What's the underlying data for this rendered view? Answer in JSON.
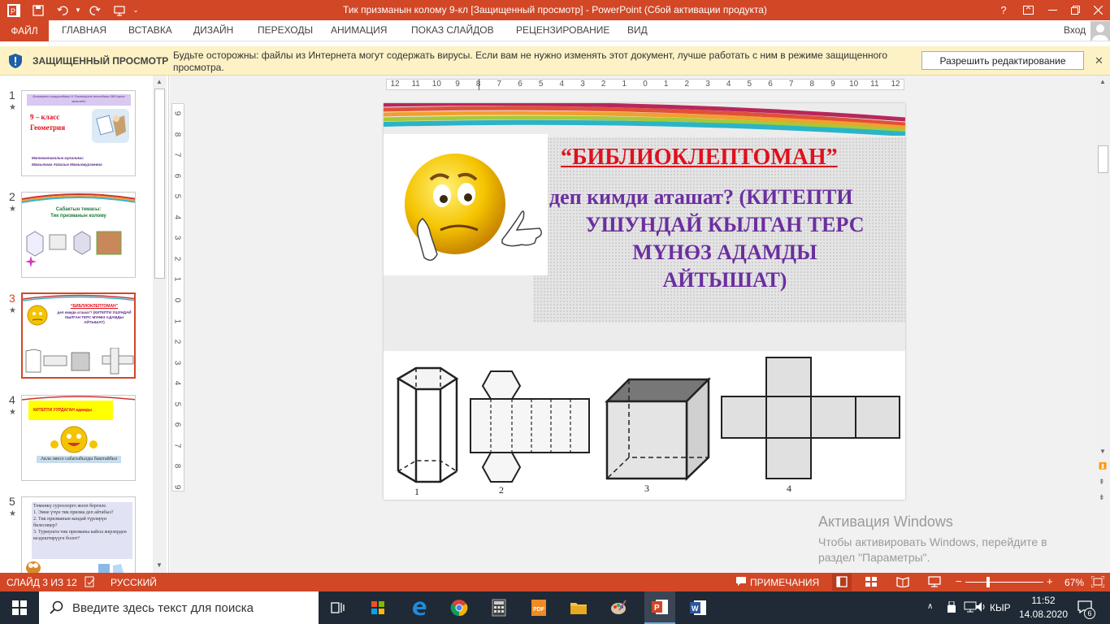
{
  "window": {
    "title": "Тик призманын колому 9-кл [Защищенный просмотр] -  PowerPoint (Сбой активации продукта)",
    "help": "?"
  },
  "ribbon": {
    "tabs": [
      "ФАЙЛ",
      "ГЛАВНАЯ",
      "ВСТАВКА",
      "ДИЗАЙН",
      "ПЕРЕХОДЫ",
      "АНИМАЦИЯ",
      "ПОКАЗ СЛАЙДОВ",
      "РЕЦЕНЗИРОВАНИЕ",
      "ВИД"
    ],
    "signin": "Вход"
  },
  "protected": {
    "label": "ЗАЩИЩЕННЫЙ ПРОСМОТР",
    "message": "Будьте осторожны: файлы из Интернета могут содержать вирусы. Если вам не нужно изменять этот документ, лучше работать с ним в режиме защищенного просмотра.",
    "button": "Разрешить редактирование"
  },
  "thumbnails": [
    {
      "num": "1",
      "star": "★",
      "line1": "Бозмерген шаарындагы Н.Токтогулов атындагы №8 орто мектеби",
      "title1": "9 – класс",
      "title2": "Геометрия",
      "footer1": "Математикалык мугалими:",
      "footer2": "Мамытова Айгазык Мамыкмурзаевна"
    },
    {
      "num": "2",
      "star": "★",
      "line1": "Сабактын темасы:",
      "line2": "Тик призманын колому"
    },
    {
      "num": "3",
      "star": "★",
      "line1": "“БИБЛИОКЛЕПТОМАН”",
      "line2": "деп кимди аташат? (КИТЕПТИ УШУНДАЙ КЫЛГАН ТЕРС МҮНӨЗ АДАМДЫ АЙТЫШАТ)"
    },
    {
      "num": "4",
      "star": "★",
      "line1": "КИТЕПТИ УУРДАГАН адамды",
      "line2": "Акла эмесе сабагыбызды баштайбыз"
    },
    {
      "num": "5",
      "star": "★",
      "text": "Төмөнкү суроолорго жооп бергиле.\n1. Эмне үчүн тик призма деп айтабыз?\n2. Тик призманын кандай түрлөрүн билесиңер?\n3. Турмушта тик призманы кайсы жерлерден кездештирүүгө болот?"
    }
  ],
  "ruler": {
    "h": [
      "12",
      "11",
      "10",
      "9",
      "8",
      "7",
      "6",
      "5",
      "4",
      "3",
      "2",
      "1",
      "0",
      "1",
      "2",
      "3",
      "4",
      "5",
      "6",
      "7",
      "8",
      "9",
      "10",
      "11",
      "12"
    ],
    "v": [
      "9",
      "8",
      "7",
      "6",
      "5",
      "4",
      "3",
      "2",
      "1",
      "0",
      "1",
      "2",
      "3",
      "4",
      "5",
      "6",
      "7",
      "8",
      "9"
    ]
  },
  "slide": {
    "heading": "“БИБЛИОКЛЕПТОМАН”",
    "lines": [
      "деп кимди аташат?  (КИТЕПТИ",
      "УШУНДАЙ КЫЛГАН ТЕРС",
      "МҮНӨЗ АДАМДЫ",
      "АЙТЫШАТ)"
    ],
    "figure_labels": [
      "1",
      "2",
      "3",
      "4"
    ]
  },
  "activation": {
    "title": "Активация Windows",
    "line1": "Чтобы активировать Windows, перейдите в",
    "line2": "раздел \"Параметры\"."
  },
  "status": {
    "slide": "СЛАЙД 3 ИЗ 12",
    "language": "РУССКИЙ",
    "notes": "ПРИМЕЧАНИЯ",
    "zoom": "67%"
  },
  "taskbar": {
    "search_placeholder": "Введите здесь текст для поиска",
    "lang": "КЫР",
    "time": "11:52",
    "date": "14.08.2020",
    "notif_count": "6"
  },
  "colors": {
    "accent": "#d24726",
    "slide_heading": "#e0101e",
    "slide_text": "#6b2fa0",
    "protected_bg": "#fdf2c6"
  }
}
